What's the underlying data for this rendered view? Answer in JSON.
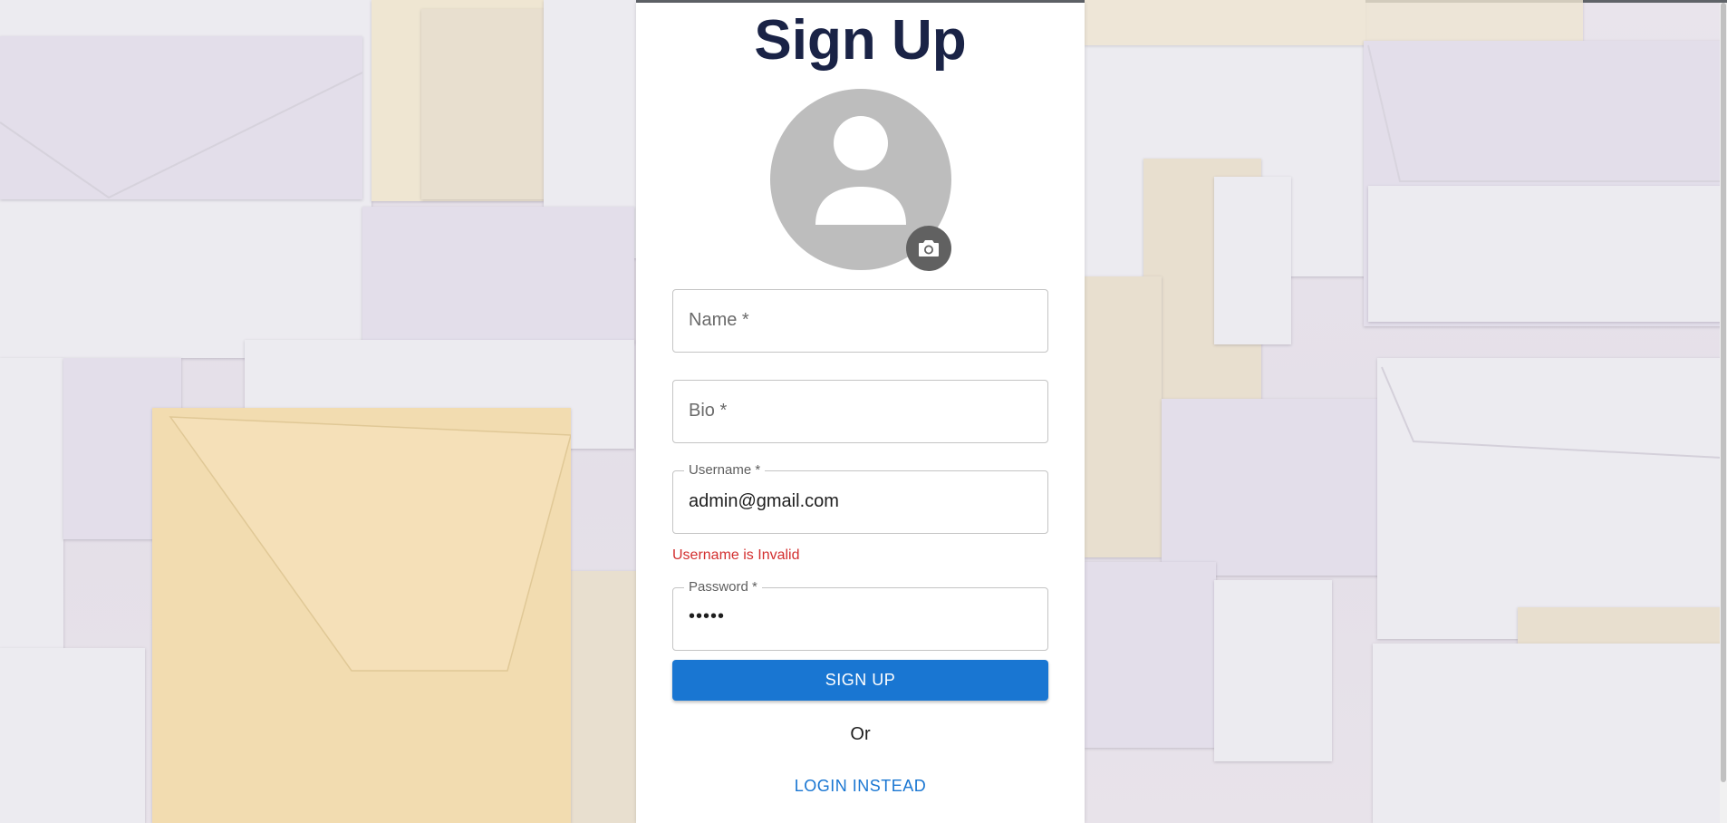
{
  "form": {
    "title": "Sign Up",
    "name_field": {
      "label": "Name *",
      "value": ""
    },
    "bio_field": {
      "label": "Bio *",
      "value": ""
    },
    "username_field": {
      "label": "Username *",
      "value": "admin@gmail.com"
    },
    "username_error": "Username is Invalid",
    "password_field": {
      "label": "Password *",
      "value": "•••••"
    },
    "signup_label": "SIGN UP",
    "or_text": "Or",
    "login_label": "LOGIN INSTEAD"
  },
  "icons": {
    "avatar": "person-icon",
    "upload": "camera-icon"
  },
  "colors": {
    "primary": "#1976d2",
    "error": "#d32f2f",
    "title": "#1a2346",
    "avatar_bg": "#bdbdbd"
  }
}
